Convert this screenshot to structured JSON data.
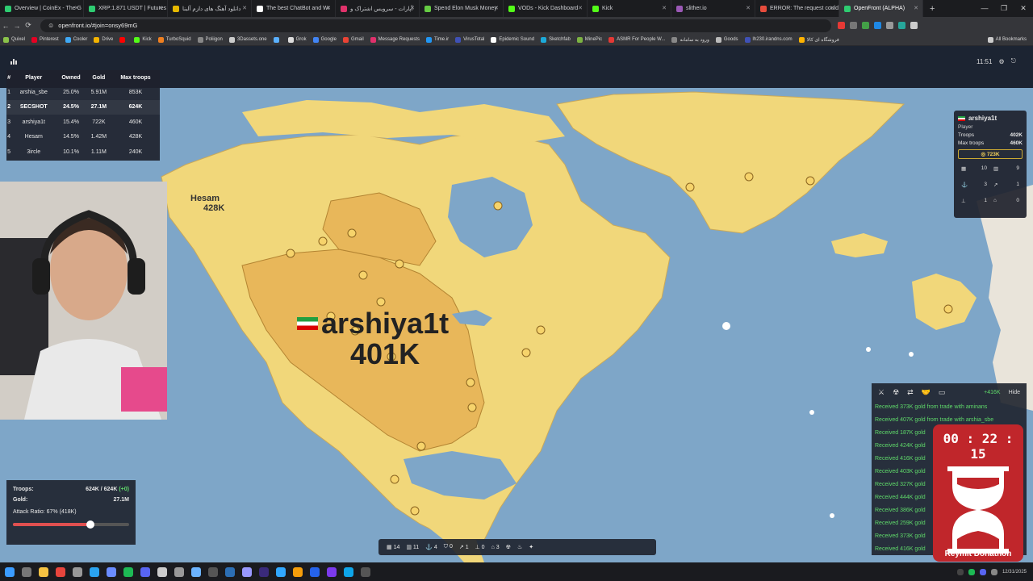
{
  "browser": {
    "tabs": [
      {
        "title": "Overview | CoinEx - The G",
        "color": "#2ecc71"
      },
      {
        "title": "XRP:1.871 USDT | Futures",
        "color": "#2ecc71"
      },
      {
        "title": "دانلود آهنگ های دازم آلبنا",
        "color": "#e6b800"
      },
      {
        "title": "The best ChatBot and Wr",
        "color": "#ffffff"
      },
      {
        "title": "آپارات - سرویس اشتراک و",
        "color": "#e0326b"
      },
      {
        "title": "Spend Elon Musk Money",
        "color": "#66cc44"
      },
      {
        "title": "VODs - Kick Dashboard",
        "color": "#53fc18"
      },
      {
        "title": "Kick",
        "color": "#53fc18"
      },
      {
        "title": "slither.io",
        "color": "#9b59b6"
      },
      {
        "title": "ERROR: The request could",
        "color": "#e74c3c"
      },
      {
        "title": "OpenFront (ALPHA)",
        "color": "#2ecc71",
        "active": true
      }
    ],
    "url": "openfront.io/#join=onsy69mG",
    "bookmarks": [
      {
        "label": "Quixel",
        "color": "#8bc34a"
      },
      {
        "label": "Pinterest",
        "color": "#e60023"
      },
      {
        "label": "Cooler",
        "color": "#3fa9f5"
      },
      {
        "label": "Drive",
        "color": "#f4b400"
      },
      {
        "label": "",
        "color": "#ff0000"
      },
      {
        "label": "Kick",
        "color": "#53fc18"
      },
      {
        "label": "TurboSquid",
        "color": "#f08020"
      },
      {
        "label": "Poliigon",
        "color": "#888888"
      },
      {
        "label": "3Dassets.one",
        "color": "#cccccc"
      },
      {
        "label": "",
        "color": "#5ab0ff"
      },
      {
        "label": "Grok",
        "color": "#dddddd"
      },
      {
        "label": "Google",
        "color": "#4285f4"
      },
      {
        "label": "Gmail",
        "color": "#ea4335"
      },
      {
        "label": "Message Requests",
        "color": "#e1306c"
      },
      {
        "label": "Time.ir",
        "color": "#2196f3"
      },
      {
        "label": "VirusTotal",
        "color": "#3f51b5"
      },
      {
        "label": "Epidemic Sound",
        "color": "#ffffff"
      },
      {
        "label": "Sketchfab",
        "color": "#1caad9"
      },
      {
        "label": "MinePic",
        "color": "#7cb342"
      },
      {
        "label": "ASMR For People W...",
        "color": "#e53935"
      },
      {
        "label": "ورود به سامانه",
        "color": "#888888"
      },
      {
        "label": "Goods",
        "color": "#bbbbbb"
      },
      {
        "label": "lh230.irandns.com",
        "color": "#3f51b5"
      },
      {
        "label": "فروشگاه ای کالا",
        "color": "#ffb300"
      },
      {
        "label": "All Bookmarks",
        "color": "#cccccc"
      }
    ]
  },
  "leaderboard": {
    "headers": [
      "#",
      "Player",
      "Owned",
      "Gold",
      "Max troops"
    ],
    "rows": [
      {
        "rank": "1",
        "player": "arshia_sbe",
        "owned": "25.0%",
        "gold": "5.91M",
        "max": "853K"
      },
      {
        "rank": "2",
        "player": "SECSHOT",
        "owned": "24.5%",
        "gold": "27.1M",
        "max": "624K",
        "me": true
      },
      {
        "rank": "3",
        "player": "arshiya1t",
        "owned": "15.4%",
        "gold": "722K",
        "max": "460K"
      },
      {
        "rank": "4",
        "player": "Hesam",
        "owned": "14.5%",
        "gold": "1.42M",
        "max": "428K"
      },
      {
        "rank": "5",
        "player": "3ircle",
        "owned": "10.1%",
        "gold": "1.11M",
        "max": "240K"
      }
    ]
  },
  "map": {
    "label_main_name": "arshiya1t",
    "label_main_troops": "401K",
    "label_hesam_name": "Hesam",
    "label_hesam_troops": "428K",
    "land_color": "#f1d77a",
    "territory_color": "#e8b75a",
    "ocean_color": "#7ea6c8"
  },
  "clock": {
    "time": "11:51"
  },
  "player_panel": {
    "name": "arshiya1t",
    "type": "Player",
    "troops_label": "Troops",
    "troops": "402K",
    "max_troops_label": "Max troops",
    "max_troops": "460K",
    "gold": "723K",
    "stats": [
      "10",
      "9",
      "3",
      "1",
      "1",
      "0"
    ]
  },
  "events": {
    "gain": "+416K",
    "hide": "Hide",
    "messages": [
      "Received 373K gold from trade with aminans",
      "Received 407K gold from trade with arshia_sbe",
      "Received 187K gold",
      "Received 424K gold",
      "Received 416K gold",
      "Received 403K gold",
      "Received 327K gold",
      "Received 444K gold",
      "Received 386K gold",
      "Received 259K gold",
      "Received 373K gold",
      "Received 416K gold"
    ]
  },
  "status": {
    "troops_label": "Troops:",
    "troops_value": "624K / 624K",
    "troops_delta": "(+0)",
    "gold_label": "Gold:",
    "gold_value": "27.1M",
    "attack_ratio_text": "Attack Ratio: 67% (418K)",
    "attack_ratio": 0.67
  },
  "build_bar": {
    "counts": [
      "14",
      "11",
      "4",
      "0",
      "1",
      "0",
      "3"
    ]
  },
  "timer": {
    "digits": "00 : 22 : 15",
    "label": "Reymit Donathon"
  },
  "taskbar": {
    "date": "12/31/2025"
  }
}
